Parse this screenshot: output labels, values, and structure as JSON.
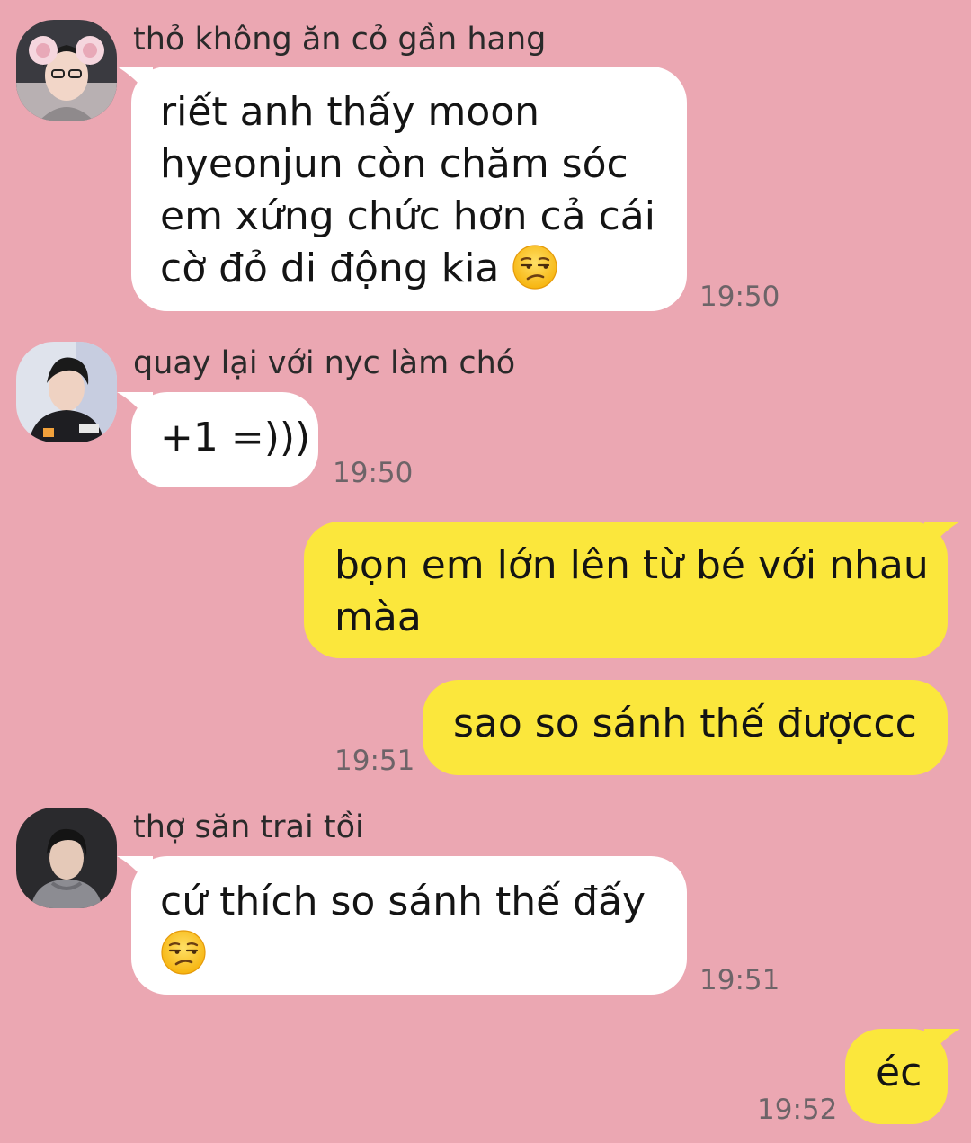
{
  "chat": {
    "colors": {
      "background": "#eba7b2",
      "incoming_bubble": "#ffffff",
      "outgoing_bubble": "#fbe73c",
      "timestamp": "#6d6468"
    },
    "messages": [
      {
        "sender": "thỏ không ăn cỏ gần hang",
        "lines": [
          "riết anh thấy moon",
          "hyeonjun còn chăm sóc",
          "em xứng chức hơn cả cái",
          "cờ đỏ di động kia"
        ],
        "emoji": "unamused-face-emoji",
        "time": "19:50",
        "direction": "incoming",
        "avatar": "avatar-icon"
      },
      {
        "sender": "quay lại với nyc làm chó",
        "lines": [
          "+1 =)))"
        ],
        "time": "19:50",
        "direction": "incoming",
        "avatar": "avatar-icon"
      },
      {
        "lines": [
          "bọn em lớn lên từ bé với nhau",
          "màa"
        ],
        "direction": "outgoing"
      },
      {
        "lines": [
          "sao so sánh thế đượccc"
        ],
        "time": "19:51",
        "direction": "outgoing"
      },
      {
        "sender": "thợ săn trai tồi",
        "lines": [
          "cứ thích so sánh thế đấy"
        ],
        "emoji": "unamused-face-emoji",
        "time": "19:51",
        "direction": "incoming",
        "avatar": "avatar-icon"
      },
      {
        "lines": [
          "éc"
        ],
        "time": "19:52",
        "direction": "outgoing"
      }
    ]
  }
}
